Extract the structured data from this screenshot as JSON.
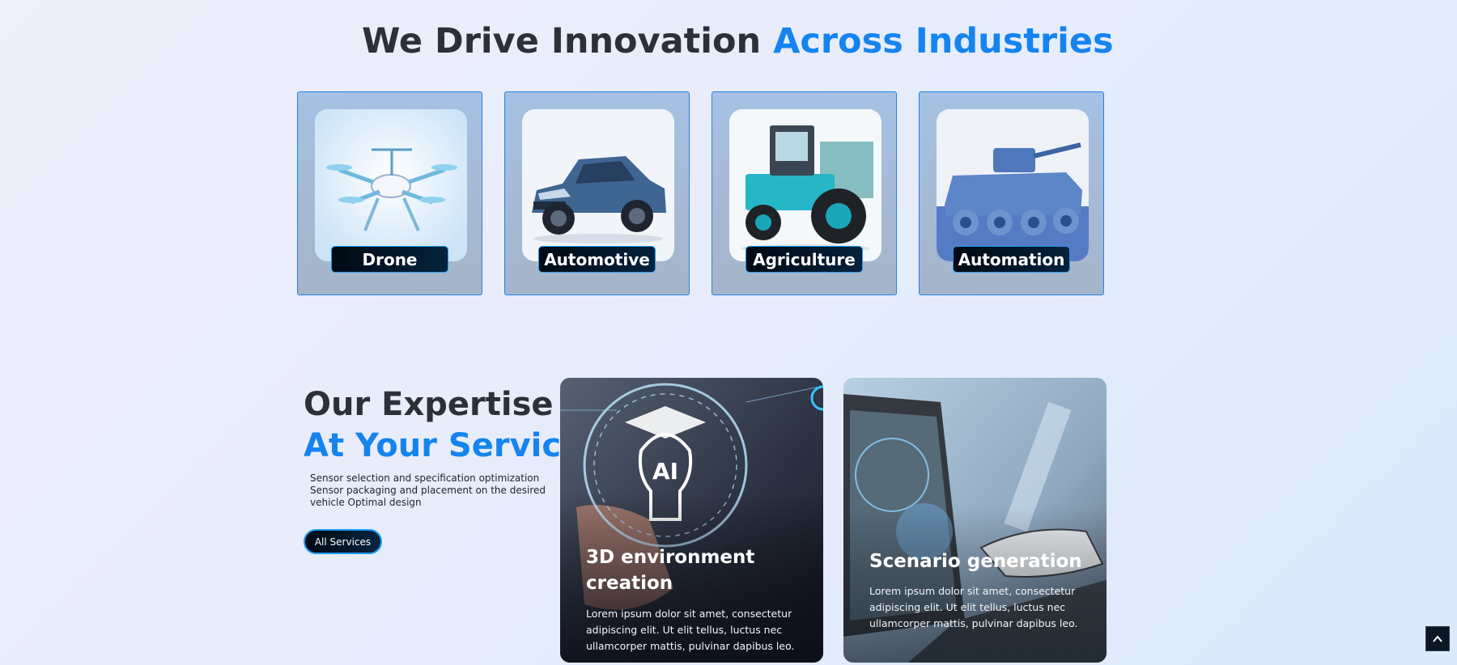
{
  "hero": {
    "title_plain": "We Drive Innovation",
    "title_accent": "Across Industries"
  },
  "industries": [
    {
      "label": "Drone",
      "icon": "drone-image"
    },
    {
      "label": "Automotive",
      "icon": "suv-image"
    },
    {
      "label": "Agriculture",
      "icon": "tractor-image"
    },
    {
      "label": "Automation",
      "icon": "armored-vehicle-image"
    }
  ],
  "expertise": {
    "title_plain": "Our Expertise",
    "title_accent": "At Your Service",
    "description": "Sensor selection and specification optimization Sensor packaging and placement on the desired vehicle Optimal design",
    "button_label": "All Services"
  },
  "services": [
    {
      "title": "3D environment creation",
      "text": "Lorem ipsum dolor sit amet, consectetur adipiscing elit. Ut elit tellus, luctus nec ullamcorper mattis, pulvinar dapibus leo.",
      "icon": "ai-lightbulb-image"
    },
    {
      "title": "Scenario generation",
      "text": "Lorem ipsum dolor sit amet, consectetur adipiscing elit. Ut elit tellus, luctus nec ullamcorper mattis, pulvinar dapibus leo.",
      "icon": "robot-hand-laptop-image"
    }
  ],
  "scroll_top": {
    "icon": "chevron-up-icon"
  },
  "colors": {
    "accent": "#1584ee",
    "heading": "#2c3038",
    "label_bg": "#000a14",
    "card_border": "#1f82ea"
  }
}
